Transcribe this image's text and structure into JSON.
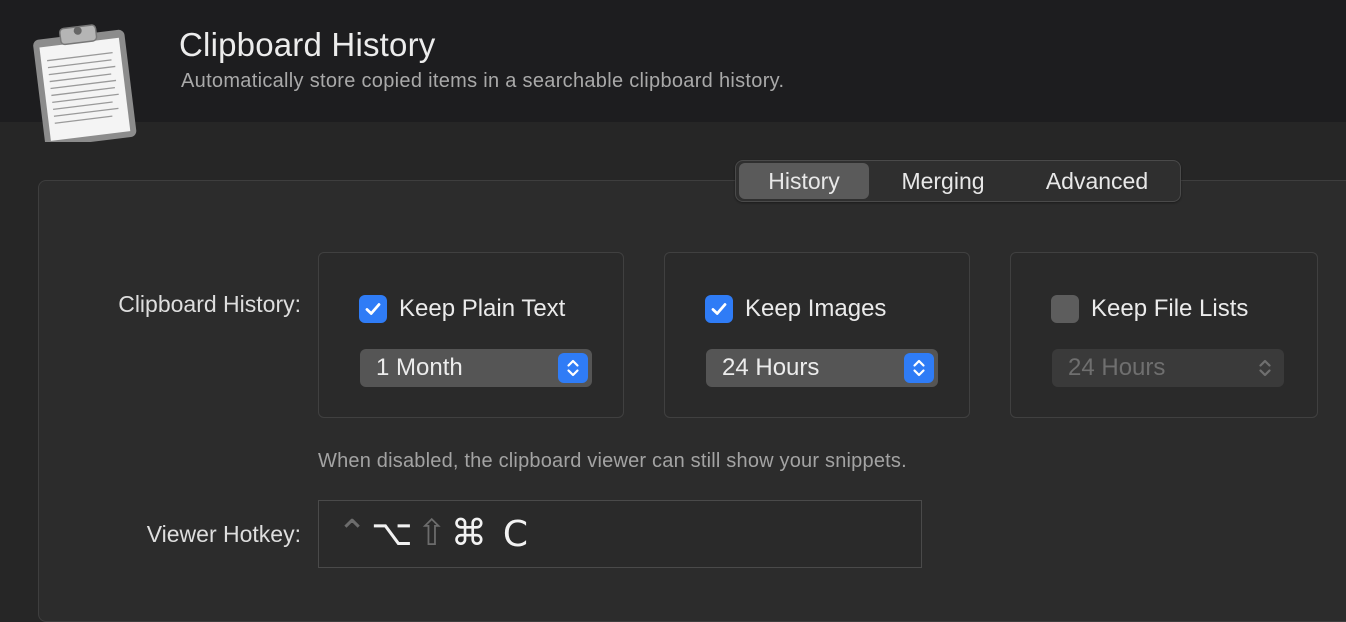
{
  "header": {
    "title": "Clipboard History",
    "subtitle": "Automatically store copied items in a searchable clipboard history."
  },
  "tabs": [
    {
      "label": "History",
      "active": true
    },
    {
      "label": "Merging",
      "active": false
    },
    {
      "label": "Advanced",
      "active": false
    }
  ],
  "history": {
    "row_label": "Clipboard History:",
    "groups": [
      {
        "label": "Keep Plain Text",
        "checked": true,
        "duration": "1 Month",
        "enabled": true
      },
      {
        "label": "Keep Images",
        "checked": true,
        "duration": "24 Hours",
        "enabled": true
      },
      {
        "label": "Keep File Lists",
        "checked": false,
        "duration": "24 Hours",
        "enabled": false
      }
    ],
    "hint": "When disabled, the clipboard viewer can still show your snippets."
  },
  "hotkey": {
    "label": "Viewer Hotkey:",
    "modifiers": [
      {
        "glyph": "⌃",
        "name": "control",
        "active": false
      },
      {
        "glyph": "⌥",
        "name": "option",
        "active": true
      },
      {
        "glyph": "⇧",
        "name": "shift",
        "active": false
      },
      {
        "glyph": "⌘",
        "name": "command",
        "active": true
      }
    ],
    "key": "C"
  },
  "colors": {
    "accent": "#2f7cf6",
    "background": "#262626",
    "header": "#1d1d1f"
  }
}
